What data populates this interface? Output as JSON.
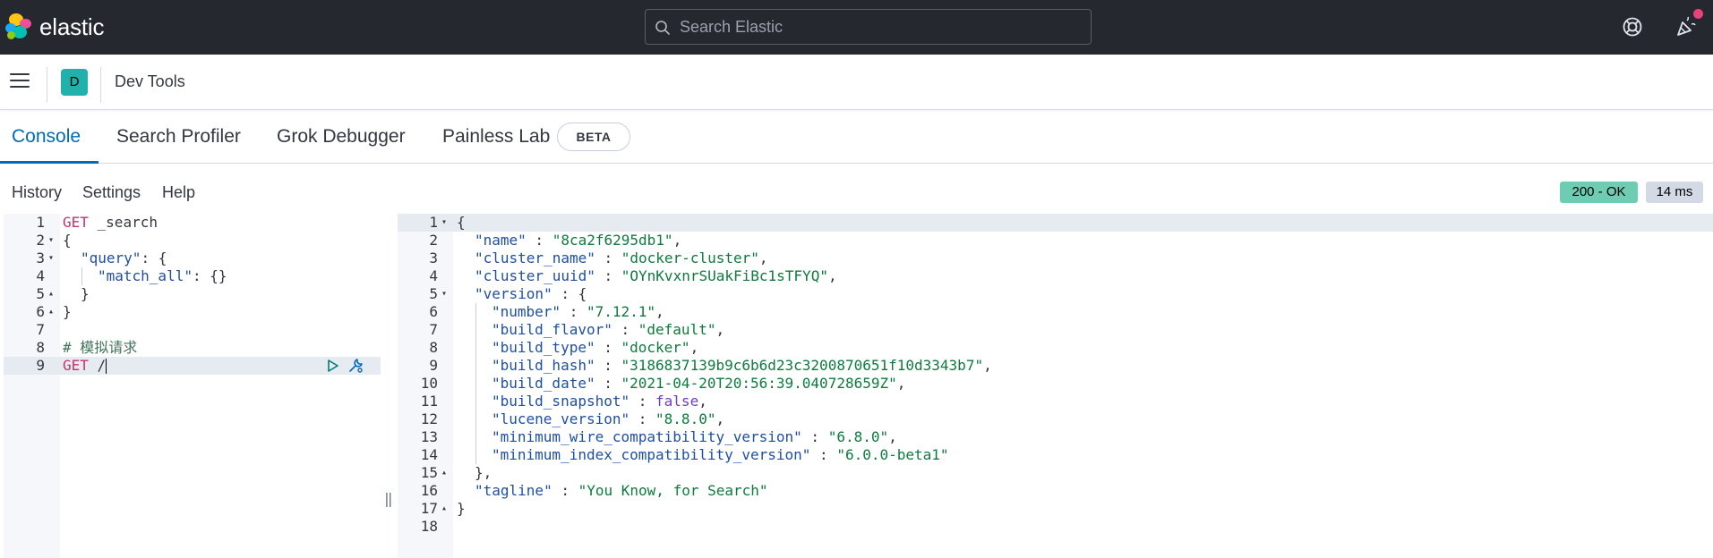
{
  "header": {
    "logo_text": "elastic",
    "search_placeholder": "Search Elastic"
  },
  "appbar": {
    "space_initial": "D",
    "breadcrumb": "Dev Tools"
  },
  "tabs": [
    {
      "label": "Console",
      "active": true
    },
    {
      "label": "Search Profiler",
      "active": false
    },
    {
      "label": "Grok Debugger",
      "active": false
    },
    {
      "label": "Painless Lab",
      "active": false
    }
  ],
  "beta_badge": "BETA",
  "console_menu": {
    "history": "History",
    "settings": "Settings",
    "help": "Help",
    "status": "200 - OK",
    "duration": "14 ms"
  },
  "request_editor": {
    "line_numbers": [
      "1",
      "2",
      "3",
      "4",
      "5",
      "6",
      "7",
      "8",
      "9"
    ],
    "lines": {
      "l1_method": "GET",
      "l1_url": " _search",
      "l2": "{",
      "l3_key": "\"query\"",
      "l3_rest": ": {",
      "l4_key": "\"match_all\"",
      "l4_rest": ": {}",
      "l5": "}",
      "l6": "}",
      "l8_comment": "# 模拟请求",
      "l9_method": "GET",
      "l9_url": " /"
    }
  },
  "response_editor": {
    "line_numbers": [
      "1",
      "2",
      "3",
      "4",
      "5",
      "6",
      "7",
      "8",
      "9",
      "10",
      "11",
      "12",
      "13",
      "14",
      "15",
      "16",
      "17",
      "18"
    ],
    "lines": {
      "l1": "{",
      "l2_key": "\"name\"",
      "l2_val": "\"8ca2f6295db1\"",
      "l3_key": "\"cluster_name\"",
      "l3_val": "\"docker-cluster\"",
      "l4_key": "\"cluster_uuid\"",
      "l4_val": "\"OYnKvxnrSUakFiBc1sTFYQ\"",
      "l5_key": "\"version\"",
      "l6_key": "\"number\"",
      "l6_val": "\"7.12.1\"",
      "l7_key": "\"build_flavor\"",
      "l7_val": "\"default\"",
      "l8_key": "\"build_type\"",
      "l8_val": "\"docker\"",
      "l9_key": "\"build_hash\"",
      "l9_val": "\"3186837139b9c6b6d23c3200870651f10d3343b7\"",
      "l10_key": "\"build_date\"",
      "l10_val": "\"2021-04-20T20:56:39.040728659Z\"",
      "l11_key": "\"build_snapshot\"",
      "l11_val": "false",
      "l12_key": "\"lucene_version\"",
      "l12_val": "\"8.8.0\"",
      "l13_key": "\"minimum_wire_compatibility_version\"",
      "l13_val": "\"6.8.0\"",
      "l14_key": "\"minimum_index_compatibility_version\"",
      "l14_val": "\"6.0.0-beta1\"",
      "l15": "},",
      "l16_key": "\"tagline\"",
      "l16_val": "\"You Know, for Search\"",
      "l17": "}"
    }
  },
  "colors": {
    "header_bg": "#25282f",
    "accent": "#006bb8",
    "status_ok": "#6dccb1",
    "space_avatar": "#20b2aa",
    "method": "#c6326d",
    "string": "#0e7a3e",
    "key": "#1f4fa1"
  }
}
